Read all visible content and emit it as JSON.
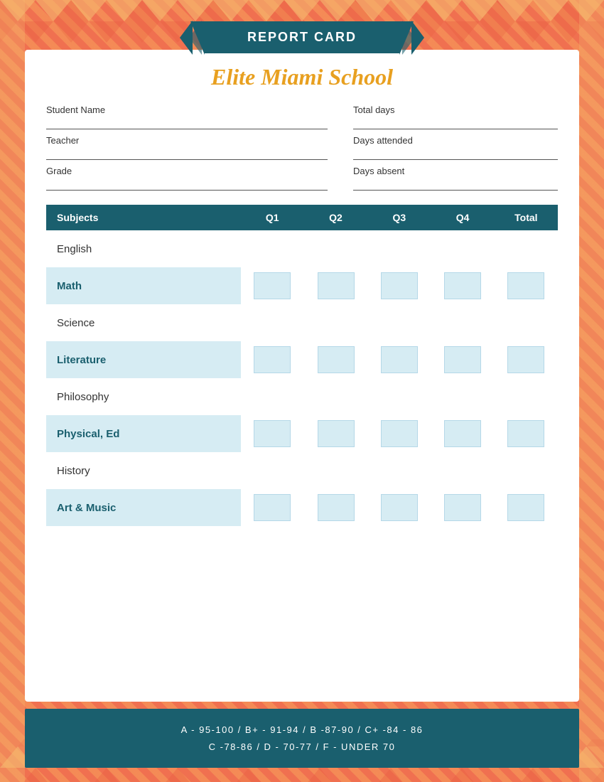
{
  "background": {
    "color": "#f07050"
  },
  "banner": {
    "title": "REPORT CARD"
  },
  "school": {
    "name": "Elite Miami School"
  },
  "fields": {
    "student_name_label": "Student Name",
    "teacher_label": "Teacher",
    "grade_label": "Grade",
    "total_days_label": "Total days",
    "days_attended_label": "Days attended",
    "days_absent_label": "Days absent"
  },
  "table": {
    "headers": {
      "subjects": "Subjects",
      "q1": "Q1",
      "q2": "Q2",
      "q3": "Q3",
      "q4": "Q4",
      "total": "Total"
    },
    "rows": [
      {
        "name": "English",
        "highlighted": false
      },
      {
        "name": "Math",
        "highlighted": true
      },
      {
        "name": "Science",
        "highlighted": false
      },
      {
        "name": "Literature",
        "highlighted": true
      },
      {
        "name": "Philosophy",
        "highlighted": false
      },
      {
        "name": "Physical, Ed",
        "highlighted": true
      },
      {
        "name": "History",
        "highlighted": false
      },
      {
        "name": "Art & Music",
        "highlighted": true
      }
    ]
  },
  "footer": {
    "line1": "A - 95-100  /  B+ - 91-94  /  B -87-90  /  C+ -84 - 86",
    "line2": "C -78-86  /  D - 70-77  /  F - UNDER 70"
  }
}
